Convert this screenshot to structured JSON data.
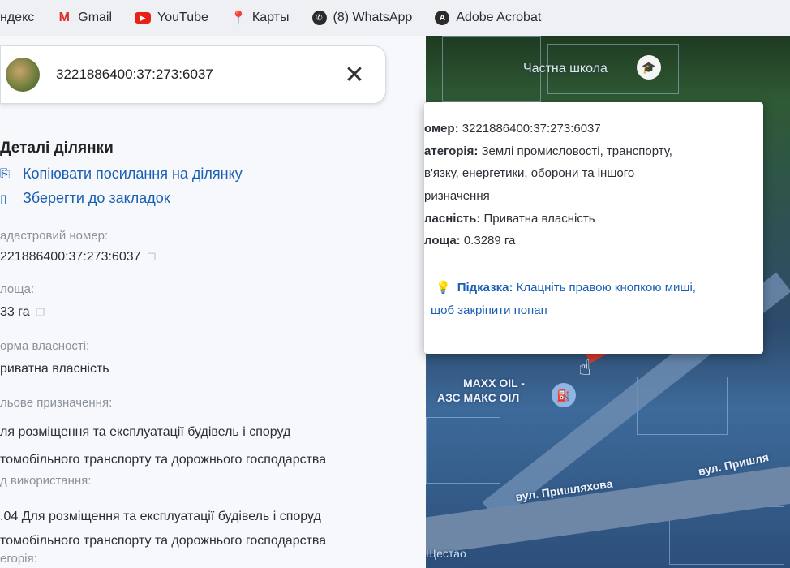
{
  "bookmarks": [
    {
      "label": "ндекс",
      "icon": "yandex-icon"
    },
    {
      "label": "Gmail",
      "icon": "gmail-icon"
    },
    {
      "label": "YouTube",
      "icon": "youtube-icon"
    },
    {
      "label": "Карты",
      "icon": "maps-icon"
    },
    {
      "label": "(8) WhatsApp",
      "icon": "whatsapp-icon"
    },
    {
      "label": "Adobe Acrobat",
      "icon": "acrobat-icon"
    }
  ],
  "search": {
    "value": "3221886400:37:273:6037"
  },
  "details": {
    "title": "Деталі ділянки",
    "copy_link": "Копіювати посилання на ділянку",
    "save_bookmark": "Зберегти до закладок",
    "cadastral_label": "адастровий номер:",
    "cadastral_value": "221886400:37:273:6037",
    "area_label": "лоща:",
    "area_value": "33 га",
    "ownership_label": "орма власності:",
    "ownership_value": "риватна власність",
    "purpose_label": "льове призначення:",
    "purpose_value_1": "ля розміщення та експлуатації будівель і споруд",
    "purpose_value_2": "томобільного транспорту та дорожнього господарства",
    "use_label": "д використання:",
    "use_value_1": ".04 Для розміщення та експлуатації будівель і споруд",
    "use_value_2": "томобільного транспорту та дорожнього господарства",
    "more_label": "егорія:"
  },
  "map": {
    "school_label": "Частна школа",
    "station_label_1": "MAXX OIL -",
    "station_label_2": "АЗС МАКС ОІЛ",
    "street_a": "вул. Пришляхова",
    "street_b": "вул. Пришля",
    "cut_label": "Щестао"
  },
  "popup": {
    "number_label": "омер:",
    "number_value": " 3221886400:37:273:6037",
    "category_label": "атегорія:",
    "category_value_1": " Землі промисловості, транспорту,",
    "category_value_2": "в'язку, енергетики, оборони та іншого",
    "category_value_3": "ризначення",
    "ownership_label": "ласність:",
    "ownership_value": " Приватна власність",
    "area_label": "лоща:",
    "area_value": " 0.3289 га",
    "hint_label": "Підказка:",
    "hint_text_1": " Клацніть правою кнопкою миші,",
    "hint_text_2": "щоб закріпити попап"
  }
}
